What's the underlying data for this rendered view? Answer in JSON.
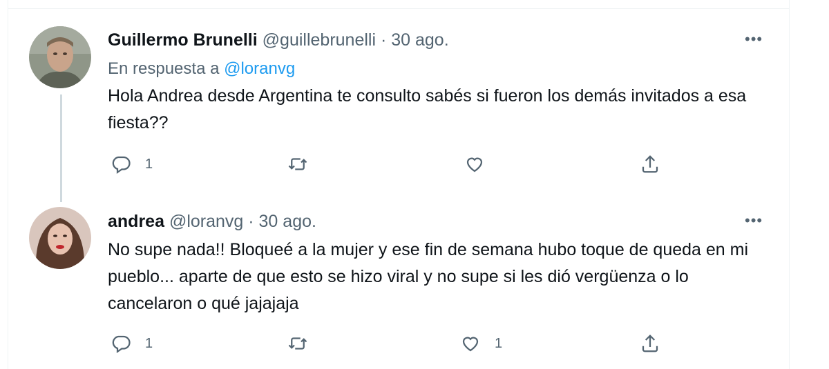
{
  "tweets": [
    {
      "name": "Guillermo Brunelli",
      "handle": "@guillebrunelli",
      "sep": " · ",
      "date": "30 ago.",
      "reply_prefix": "En respuesta a ",
      "reply_to": "@loranvg",
      "text": "Hola Andrea desde Argentina te consulto sabés si fueron los demás invitados a esa fiesta??",
      "more": "•••",
      "actions": {
        "reply_count": "1",
        "retweet_count": "",
        "like_count": ""
      }
    },
    {
      "name": "andrea",
      "handle": "@loranvg",
      "sep": " · ",
      "date": "30 ago.",
      "text": "No supe nada!! Bloqueé a la mujer y ese fin de semana hubo toque de queda en mi pueblo... aparte de que esto se hizo viral y no supe si les dió vergüenza o lo cancelaron o qué jajajaja",
      "more": "•••",
      "actions": {
        "reply_count": "1",
        "retweet_count": "",
        "like_count": "1"
      }
    }
  ],
  "icons": [
    "reply-icon",
    "retweet-icon",
    "like-icon",
    "share-icon"
  ],
  "colors": {
    "text": "#0f1419",
    "secondary": "#536471",
    "link": "#1d9bf0",
    "thread_line": "#cfd9de"
  }
}
